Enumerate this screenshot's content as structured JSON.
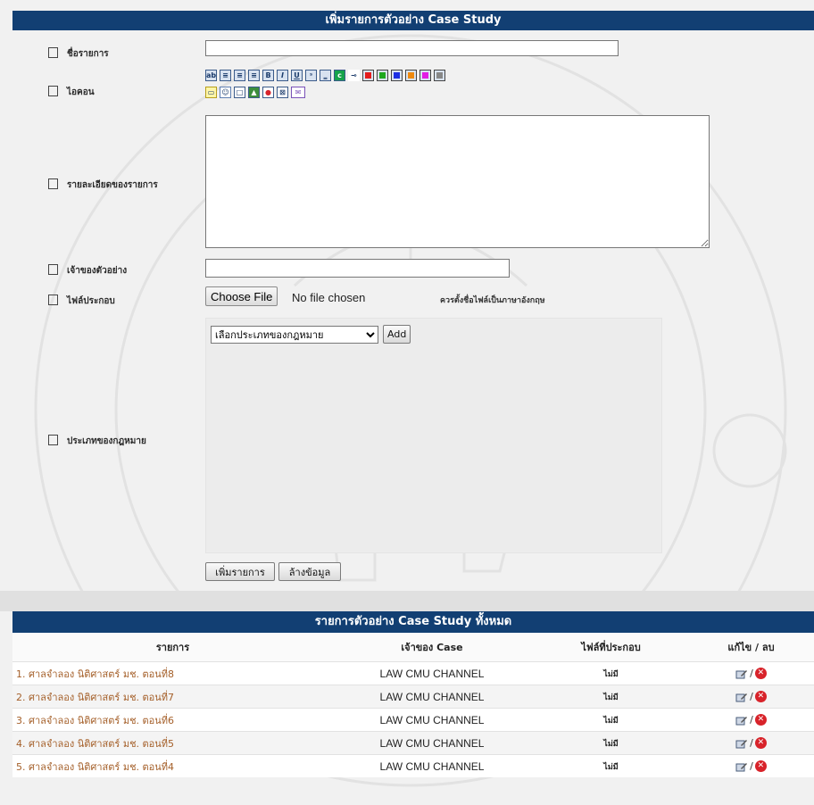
{
  "form": {
    "title": "เพิ่มรายการตัวอย่าง Case Study",
    "name_label": "ชื่อรายการ",
    "icon_label": "ไอคอน",
    "detail_label": "รายละเอียดของรายการ",
    "owner_label": "เจ้าของตัวอย่าง",
    "file_label": "ไฟล์ประกอบ",
    "file_button": "Choose File",
    "file_status": "No file chosen",
    "file_note": "ควรตั้งชื่อไฟล์เป็นภาษาอังกฤษ",
    "law_type_label": "ประเภทของกฎหมาย",
    "law_type_selected": "เลือกประเภทของกฎหมาย",
    "add_button": "Add",
    "submit_button": "เพิ่มรายการ",
    "reset_button": "ล้างข้อมูล"
  },
  "toolbar": {
    "row1": [
      "align-icon",
      "justify-left-icon",
      "justify-center-icon",
      "justify-right-icon",
      "bold-icon",
      "italic-icon",
      "underline-icon",
      "superscript-icon",
      "subscript-icon",
      "color-icon",
      "highlight-icon",
      "red-color-icon",
      "green-color-icon",
      "blue-color-icon",
      "orange-color-icon",
      "magenta-color-icon",
      "gray-color-icon"
    ],
    "row2": [
      "speech-bubble-icon",
      "emoticon-icon",
      "frame-icon",
      "image-icon",
      "flash-icon",
      "link-icon",
      "email-icon"
    ],
    "colors": {
      "red": "#e41c1c",
      "green": "#1fa81f",
      "blue": "#1c2fe4",
      "orange": "#ef8a10",
      "magenta": "#e21ce4",
      "gray": "#888888",
      "green_dot": "#16a34a"
    }
  },
  "list": {
    "title": "รายการตัวอย่าง Case Study ทั้งหมด",
    "columns": [
      "รายการ",
      "เจ้าของ Case",
      "ไฟล์ที่ประกอบ",
      "แก้ไข / ลบ"
    ],
    "rows": [
      {
        "item": "1. ศาลจำลอง นิติศาสตร์ มช. ตอนที่8",
        "owner": "LAW CMU CHANNEL",
        "file": "ไม่มี"
      },
      {
        "item": "2. ศาลจำลอง นิติศาสตร์ มช. ตอนที่7",
        "owner": "LAW CMU CHANNEL",
        "file": "ไม่มี"
      },
      {
        "item": "3. ศาลจำลอง นิติศาสตร์ มช. ตอนที่6",
        "owner": "LAW CMU CHANNEL",
        "file": "ไม่มี"
      },
      {
        "item": "4. ศาลจำลอง นิติศาสตร์ มช. ตอนที่5",
        "owner": "LAW CMU CHANNEL",
        "file": "ไม่มี"
      },
      {
        "item": "5. ศาลจำลอง นิติศาสตร์ มช. ตอนที่4",
        "owner": "LAW CMU CHANNEL",
        "file": "ไม่มี"
      }
    ],
    "separator": "/"
  },
  "theme": {
    "header_bg": "#123f73",
    "link_color": "#a5602a",
    "delete_color": "#d8232a"
  }
}
